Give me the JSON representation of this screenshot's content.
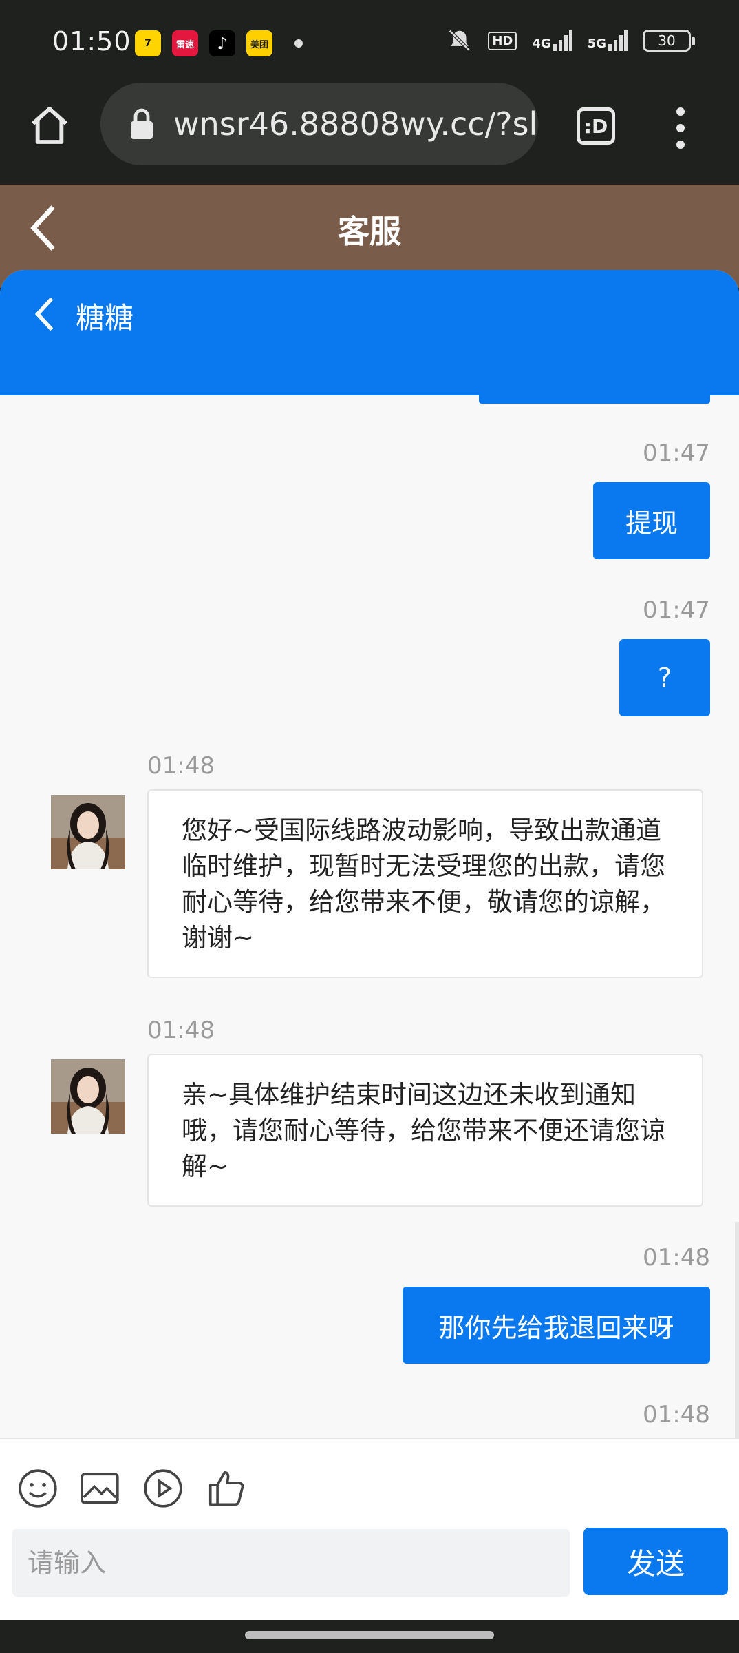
{
  "status_bar": {
    "time": "01:50",
    "app_icons": [
      {
        "name": "app-7-icon",
        "label": "7",
        "bg": "#ffd400",
        "fg": "#111"
      },
      {
        "name": "app-leisu-icon",
        "label": "雷速",
        "bg": "#e4173e",
        "fg": "#fff"
      },
      {
        "name": "tiktok-icon",
        "label": "♪",
        "bg": "#000000",
        "fg": "#fff"
      },
      {
        "name": "meituan-icon",
        "label": "美团",
        "bg": "#ffd000",
        "fg": "#222"
      }
    ],
    "hd_label": "HD",
    "signal_1": "4G",
    "signal_2": "5G",
    "battery": "30"
  },
  "browser": {
    "url": "wnsr46.88808wy.cc/?sl",
    "tabs_label": ":D"
  },
  "page_header": {
    "title": "客服"
  },
  "chat": {
    "agent_name": "糖糖",
    "messages": [
      {
        "time": "01:47",
        "text": "提现"
      },
      {
        "time": "01:47",
        "text": "?"
      },
      {
        "time": "01:48",
        "text": "您好~受国际线路波动影响，导致出款通道临时维护，现暂时无法受理您的出款，请您耐心等待，给您带来不便，敬请您的谅解，谢谢~"
      },
      {
        "time": "01:48",
        "text": "亲~具体维护结束时间这边还未收到通知哦，请您耐心等待，给您带来不便还请您谅解~"
      },
      {
        "time": "01:48",
        "text": "那你先给我退回来呀"
      },
      {
        "time": "01:48"
      }
    ]
  },
  "input": {
    "placeholder": "请输入",
    "send_label": "发送"
  },
  "colors": {
    "accent": "#0a79f0",
    "header_brown": "#7a5c4a",
    "system_bar": "#1f211f"
  }
}
